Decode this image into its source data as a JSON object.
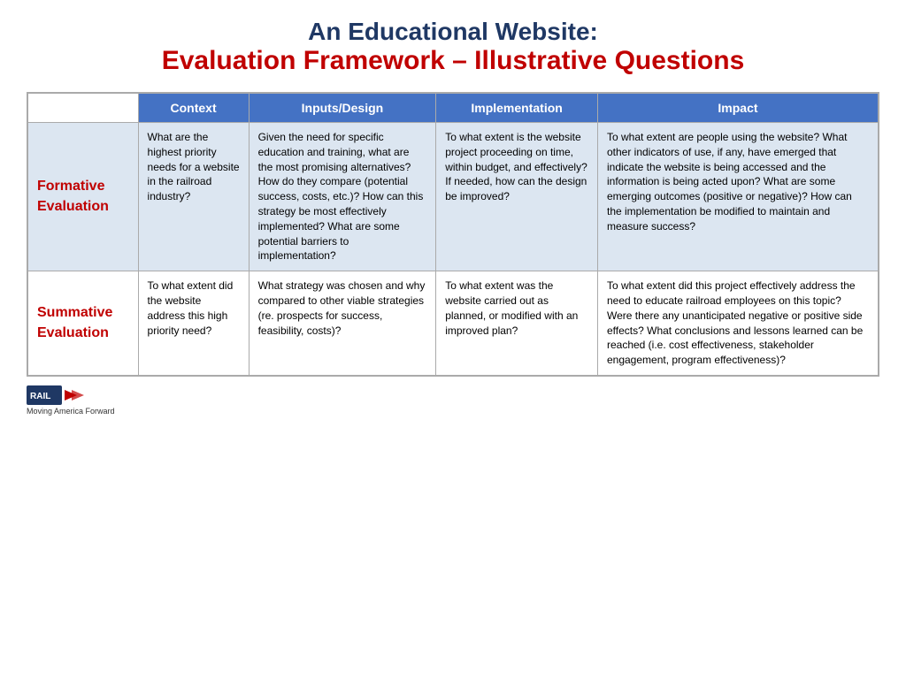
{
  "title": {
    "line1": "An Educational Website:",
    "line2": "Evaluation Framework – Illustrative Questions"
  },
  "table": {
    "headers": [
      "",
      "Context",
      "Inputs/Design",
      "Implementation",
      "Impact"
    ],
    "rows": [
      {
        "label": "Formative\nEvaluation",
        "context": "What are the highest priority needs for a website in the railroad industry?",
        "inputs_design": "Given the need for specific education and training, what are the most promising alternatives? How do they compare (potential success, costs, etc.)? How can this strategy be most effectively implemented? What are some potential barriers to implementation?",
        "implementation": "To what extent is the website project proceeding on time, within budget, and effectively?  If needed, how can the design be improved?",
        "impact": "To what extent are people using the website? What other indicators of use, if any, have emerged that indicate the website is being accessed and the information is being acted upon? What are some emerging outcomes (positive or negative)? How can the implementation be modified to maintain and measure success?"
      },
      {
        "label": "Summative\nEvaluation",
        "context": "To what extent did the website address this high priority need?",
        "inputs_design": "What strategy was chosen and why  compared to other viable strategies (re. prospects for success, feasibility, costs)?",
        "implementation": "To what extent was the website carried out as planned, or modified with an improved plan?",
        "impact": "To what extent did this project effectively address the need to educate railroad employees on this topic? Were there any unanticipated negative or positive side effects? What conclusions and lessons learned can be reached (i.e. cost effectiveness, stakeholder engagement, program effectiveness)?"
      }
    ]
  },
  "footer": {
    "logo_text": "RAIL",
    "tagline": "Moving America Forward"
  }
}
